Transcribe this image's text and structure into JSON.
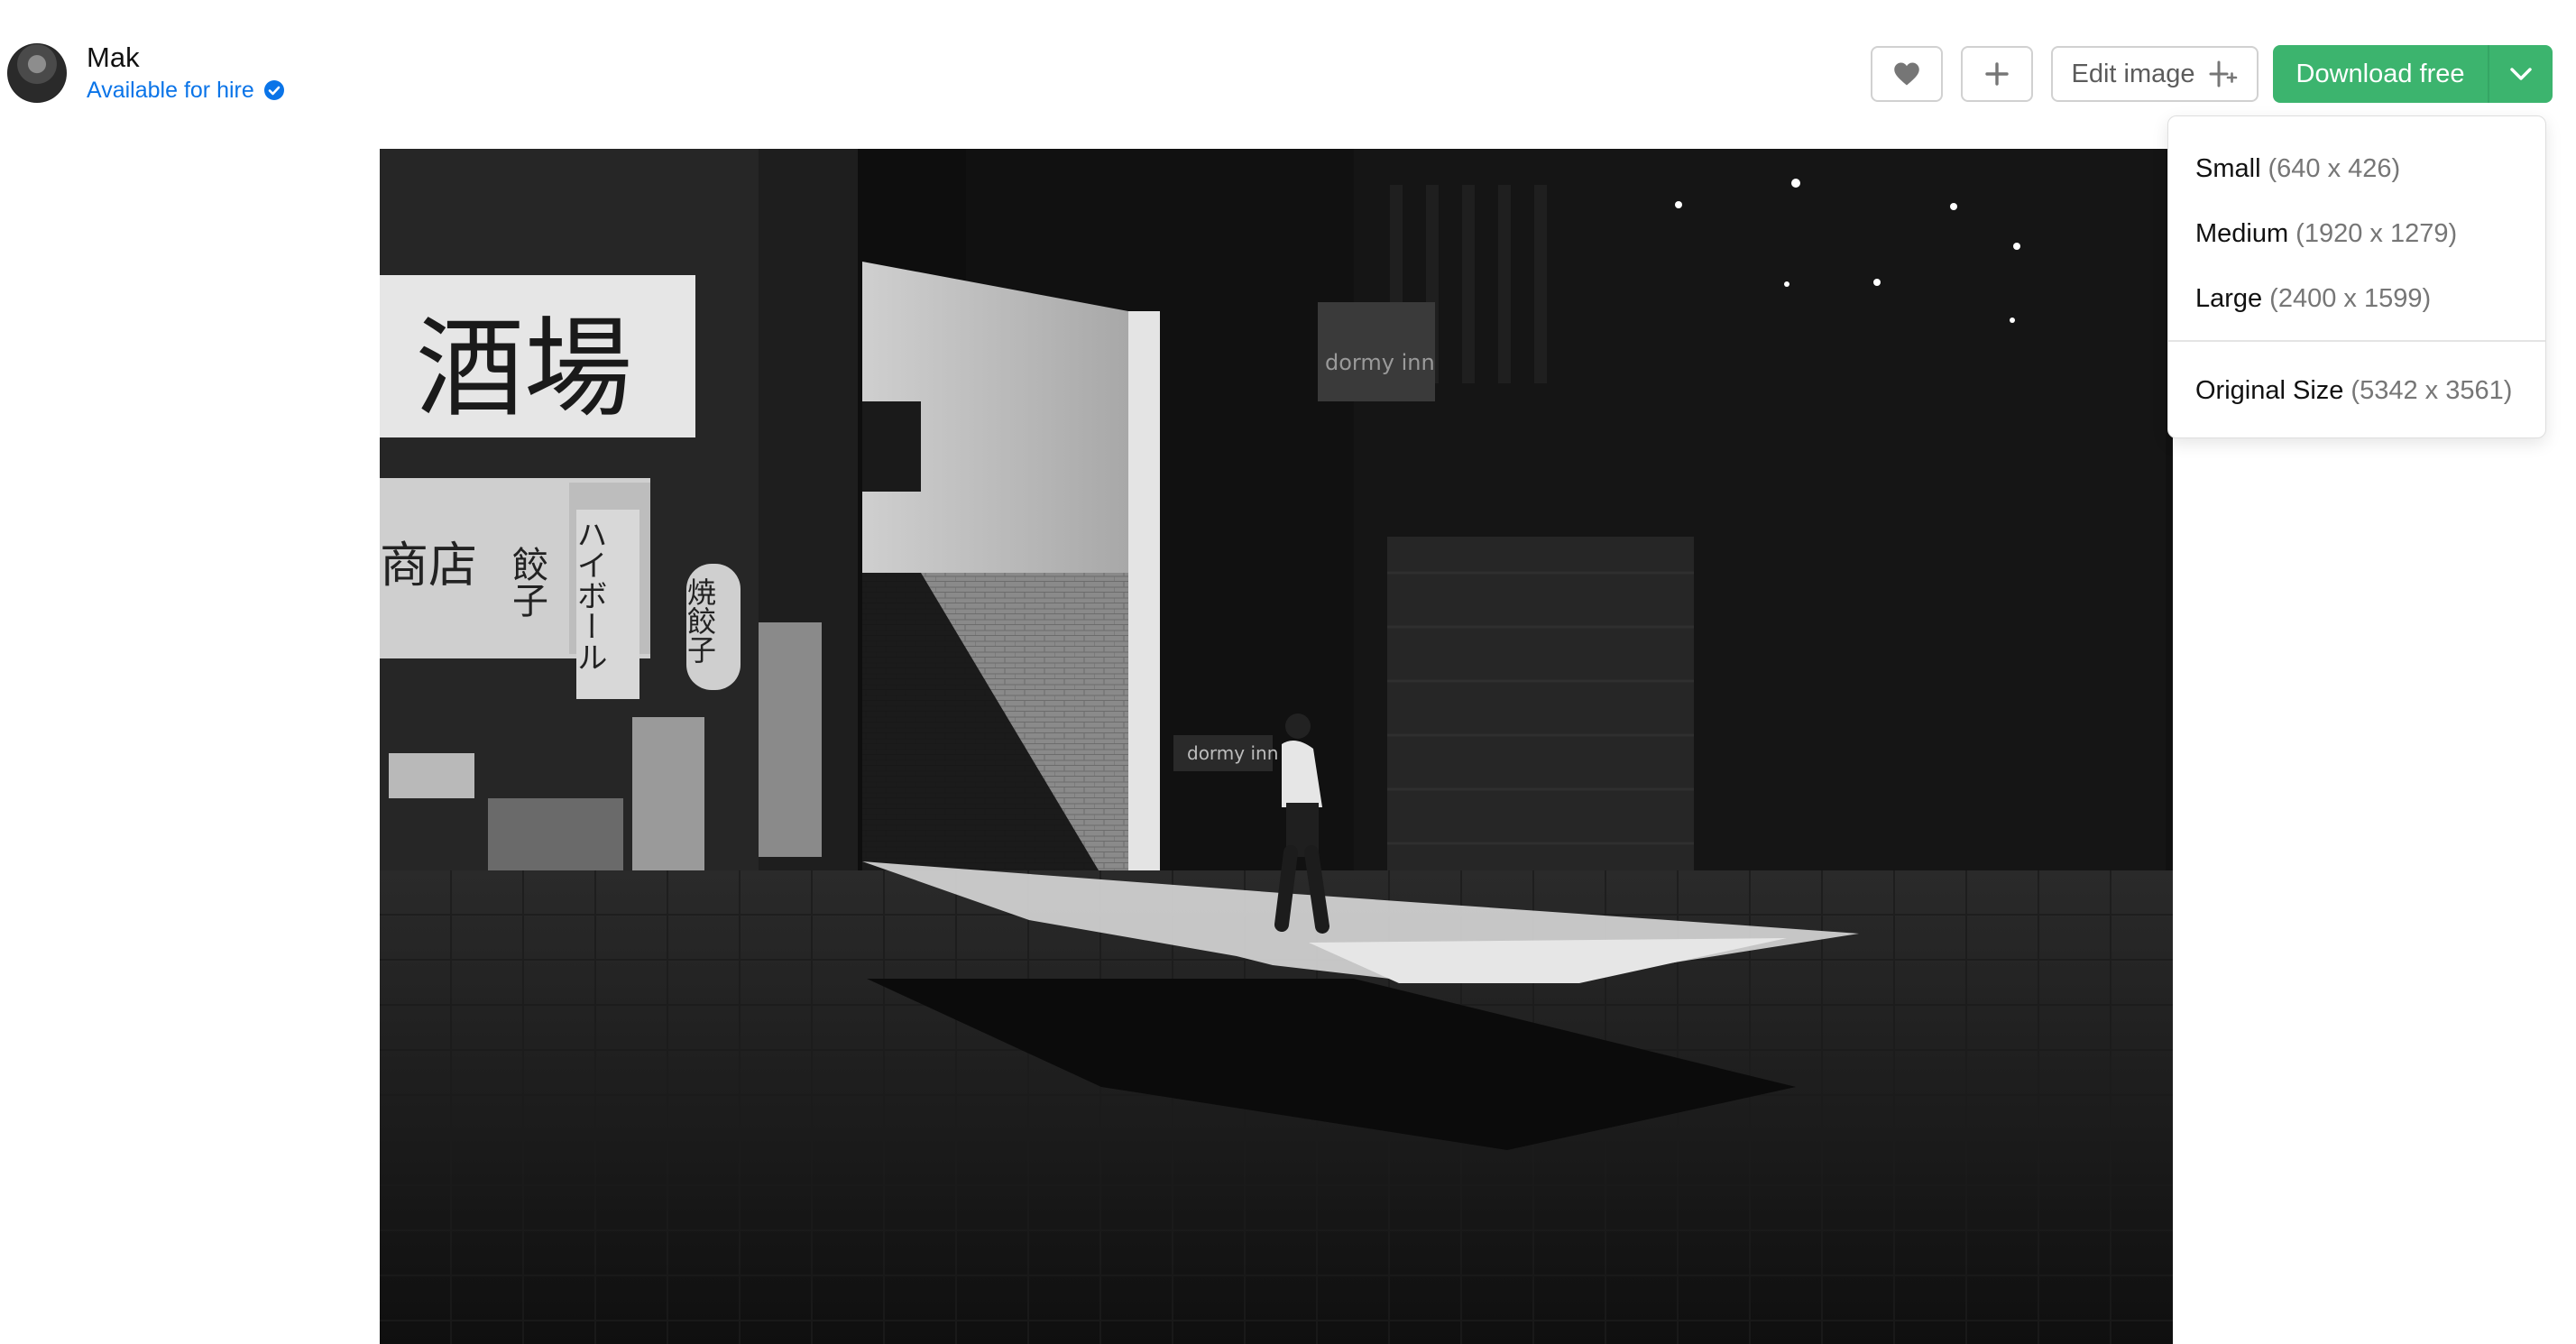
{
  "author": {
    "name": "Mak",
    "hire_label": "Available for hire"
  },
  "actions": {
    "like_icon": "heart-icon",
    "add_icon": "plus-icon",
    "edit_label": "Edit image",
    "edit_icon": "sparkle-edit-icon",
    "download_label": "Download free",
    "toggle_icon": "chevron-down-icon"
  },
  "download_menu": {
    "items": [
      {
        "label": "Small",
        "size": "(640 x 426)"
      },
      {
        "label": "Medium",
        "size": "(1920 x 1279)"
      },
      {
        "label": "Large",
        "size": "(2400 x 1599)"
      }
    ],
    "original": {
      "label": "Original Size",
      "size": "(5342 x 3561)"
    }
  },
  "photo": {
    "signs": [
      "酒場",
      "餃子",
      "ハイボール",
      "商店",
      "焼餃子",
      "dormy inn"
    ]
  },
  "colors": {
    "accent_green": "#3cb46e",
    "link_blue": "#0a74e8",
    "border_gray": "#d1d1d1"
  }
}
